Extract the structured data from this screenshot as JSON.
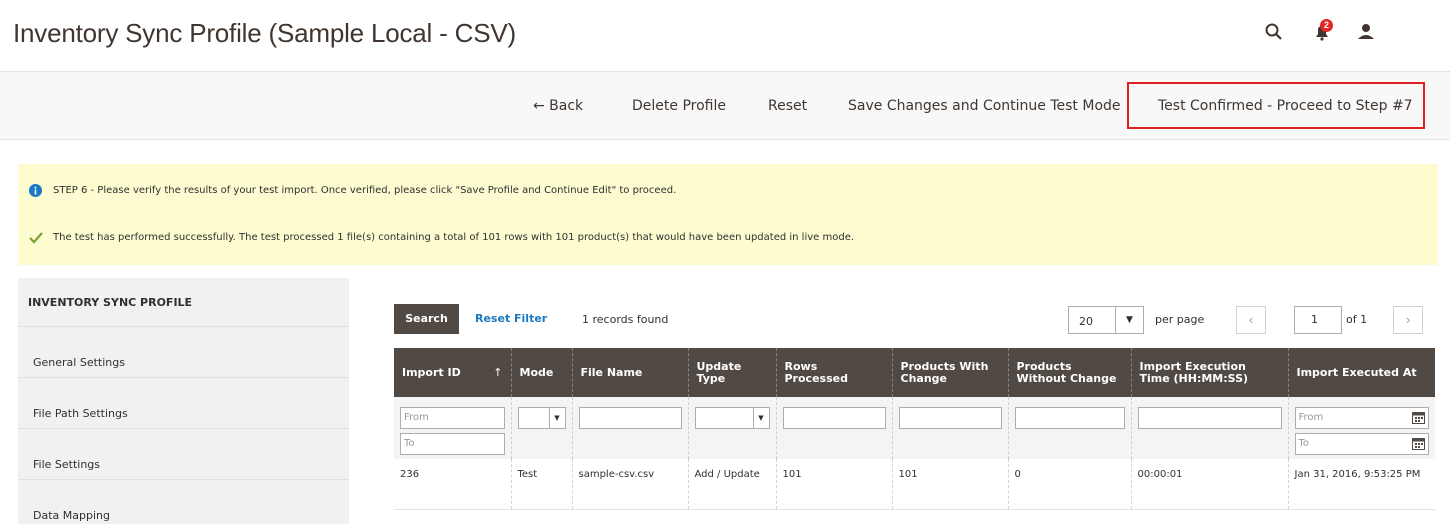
{
  "header": {
    "title": "Inventory Sync Profile (Sample Local - CSV)",
    "notification_count": "2"
  },
  "actions": {
    "back": "← Back",
    "delete": "Delete Profile",
    "reset": "Reset",
    "save_continue": "Save Changes and Continue Test Mode",
    "test_confirmed": "Test Confirmed - Proceed to Step #7",
    "highlight_color": "#e02020"
  },
  "messages": {
    "info": "STEP 6 - Please verify the results of your test import. Once verified, please click \"Save Profile and Continue Edit\" to proceed.",
    "success": "The test has performed successfully. The test processed 1 file(s) containing a total of 101 rows with 101 product(s) that would have been updated in live mode."
  },
  "sidebar": {
    "title": "INVENTORY SYNC PROFILE",
    "items": [
      {
        "label": "General Settings"
      },
      {
        "label": "File Path Settings"
      },
      {
        "label": "File Settings"
      },
      {
        "label": "Data Mapping"
      }
    ]
  },
  "grid": {
    "search_label": "Search",
    "reset_filter_label": "Reset Filter",
    "records_found": "1 records found",
    "per_page_value": "20",
    "per_page_label": "per page",
    "page_value": "1",
    "page_of": "of 1",
    "columns": [
      {
        "label": "Import ID"
      },
      {
        "label": "Mode"
      },
      {
        "label": "File Name"
      },
      {
        "label": "Update Type"
      },
      {
        "label": "Rows Processed"
      },
      {
        "label": "Products With Change"
      },
      {
        "label": "Products Without Change"
      },
      {
        "label": "Import Execution Time (HH:MM:SS)"
      },
      {
        "label": "Import Executed At"
      }
    ],
    "filters": {
      "from_placeholder": "From",
      "to_placeholder": "To"
    },
    "rows": [
      {
        "import_id": "236",
        "mode": "Test",
        "file_name": "sample-csv.csv",
        "update_type": "Add / Update",
        "rows_processed": "101",
        "products_with_change": "101",
        "products_without_change": "0",
        "execution_time": "00:00:01",
        "executed_at": "Jan 31, 2016, 9:53:25 PM"
      }
    ]
  },
  "colors": {
    "header_bg": "#514943",
    "link": "#1979c3",
    "message_bg": "#fdfbd0",
    "success_check": "#79a22e",
    "info_icon": "#1979c3"
  }
}
